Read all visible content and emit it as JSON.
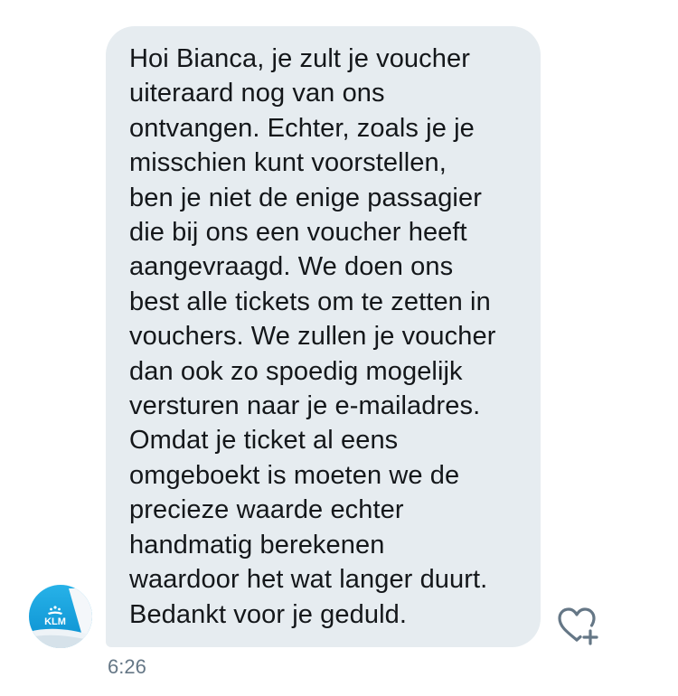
{
  "conversation": {
    "sender": {
      "avatar_icon": "klm-airline-logo-icon",
      "logo_text": "KLM",
      "accent_color": "#00a1de"
    },
    "message": {
      "lines": [
        "Hoi Bianca, je zult je voucher",
        "uiteraard nog van ons",
        "ontvangen. Echter, zoals je je",
        "misschien kunt voorstellen,",
        "ben je niet de enige passagier",
        "die bij ons een voucher heeft",
        "aangevraagd. We doen ons",
        "best alle tickets om te zetten in",
        "vouchers. We zullen je voucher",
        "dan ook zo spoedig mogelijk",
        "versturen naar je e-mailadres.",
        "Omdat je ticket al eens",
        "omgeboekt is moeten we de",
        "precieze waarde echter",
        "handmatig berekenen",
        "waardoor het wat langer duurt.",
        "Bedankt voor je geduld."
      ],
      "timestamp": "6:26",
      "bubble_color": "#e6ecf0",
      "text_color": "#14171a"
    },
    "actions": {
      "like_icon": "heart-plus-icon"
    }
  }
}
